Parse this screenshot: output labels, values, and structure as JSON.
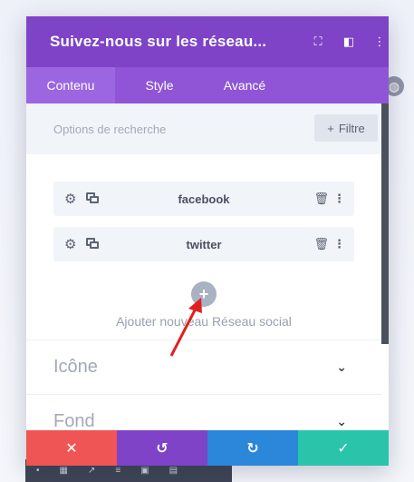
{
  "panel": {
    "title": "Suivez-nous sur les réseau...",
    "tabs": [
      "Contenu",
      "Style",
      "Avancé"
    ],
    "search_placeholder": "Options de recherche",
    "filter_label": "Filtre",
    "items": [
      {
        "label": "facebook"
      },
      {
        "label": "twitter"
      }
    ],
    "add_label": "Ajouter nouveau Réseau social",
    "sections": [
      "Icône",
      "Fond"
    ]
  },
  "icons": {
    "header": [
      "expand-icon",
      "sidebar-layout-icon",
      "more-vertical-icon"
    ],
    "footer": [
      "close-icon",
      "undo-icon",
      "redo-icon",
      "check-icon"
    ]
  },
  "colors": {
    "header": "#7e43c6",
    "tabs": "#8f55d6",
    "discard": "#ef5555",
    "undo": "#7e43c6",
    "redo": "#2b87da",
    "save": "#29c4a9",
    "annotation_arrow": "#e02020"
  }
}
